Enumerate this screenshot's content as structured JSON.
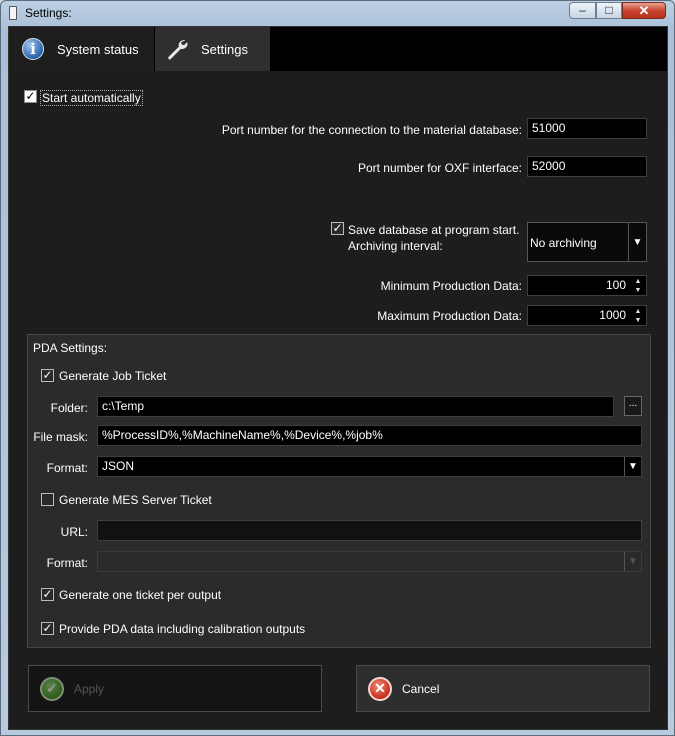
{
  "window": {
    "title": "Settings:"
  },
  "titlebar": {
    "minimize": "–",
    "maximize": "□",
    "close": "✕"
  },
  "tabs": [
    {
      "label": "System status",
      "icon": "info-icon"
    },
    {
      "label": "Settings",
      "icon": "wrench-icon",
      "active": true
    }
  ],
  "general": {
    "start_automatically": {
      "label": "Start automatically",
      "checked": true
    },
    "port_material_label": "Port number for the connection to the material database:",
    "port_material_value": "51000",
    "port_oxf_label": "Port number for OXF interface:",
    "port_oxf_value": "52000",
    "save_db": {
      "label": "Save database at program start.",
      "checked": true
    },
    "archiving_label": "Archiving interval:",
    "archiving_value": "No archiving",
    "min_prod_label": "Minimum Production Data:",
    "min_prod_value": "100",
    "max_prod_label": "Maximum Production Data:",
    "max_prod_value": "1000"
  },
  "pda": {
    "title": "PDA Settings:",
    "job_ticket": {
      "label": "Generate Job Ticket",
      "checked": true
    },
    "folder_label": "Folder:",
    "folder_value": "c:\\Temp",
    "browse_label": "...",
    "file_mask_label": "File mask:",
    "file_mask_value": "%ProcessID%,%MachineName%,%Device%,%job%",
    "format_label": "Format:",
    "format_value": "JSON",
    "mes_ticket": {
      "label": "Generate MES Server Ticket",
      "checked": false
    },
    "url_label": "URL:",
    "url_value": "",
    "format2_label": "Format:",
    "format2_value": "",
    "one_ticket": {
      "label": "Generate one ticket per output",
      "checked": true
    },
    "calibration": {
      "label": "Provide PDA data including calibration outputs",
      "checked": true
    }
  },
  "buttons": {
    "apply": "Apply",
    "cancel": "Cancel"
  }
}
